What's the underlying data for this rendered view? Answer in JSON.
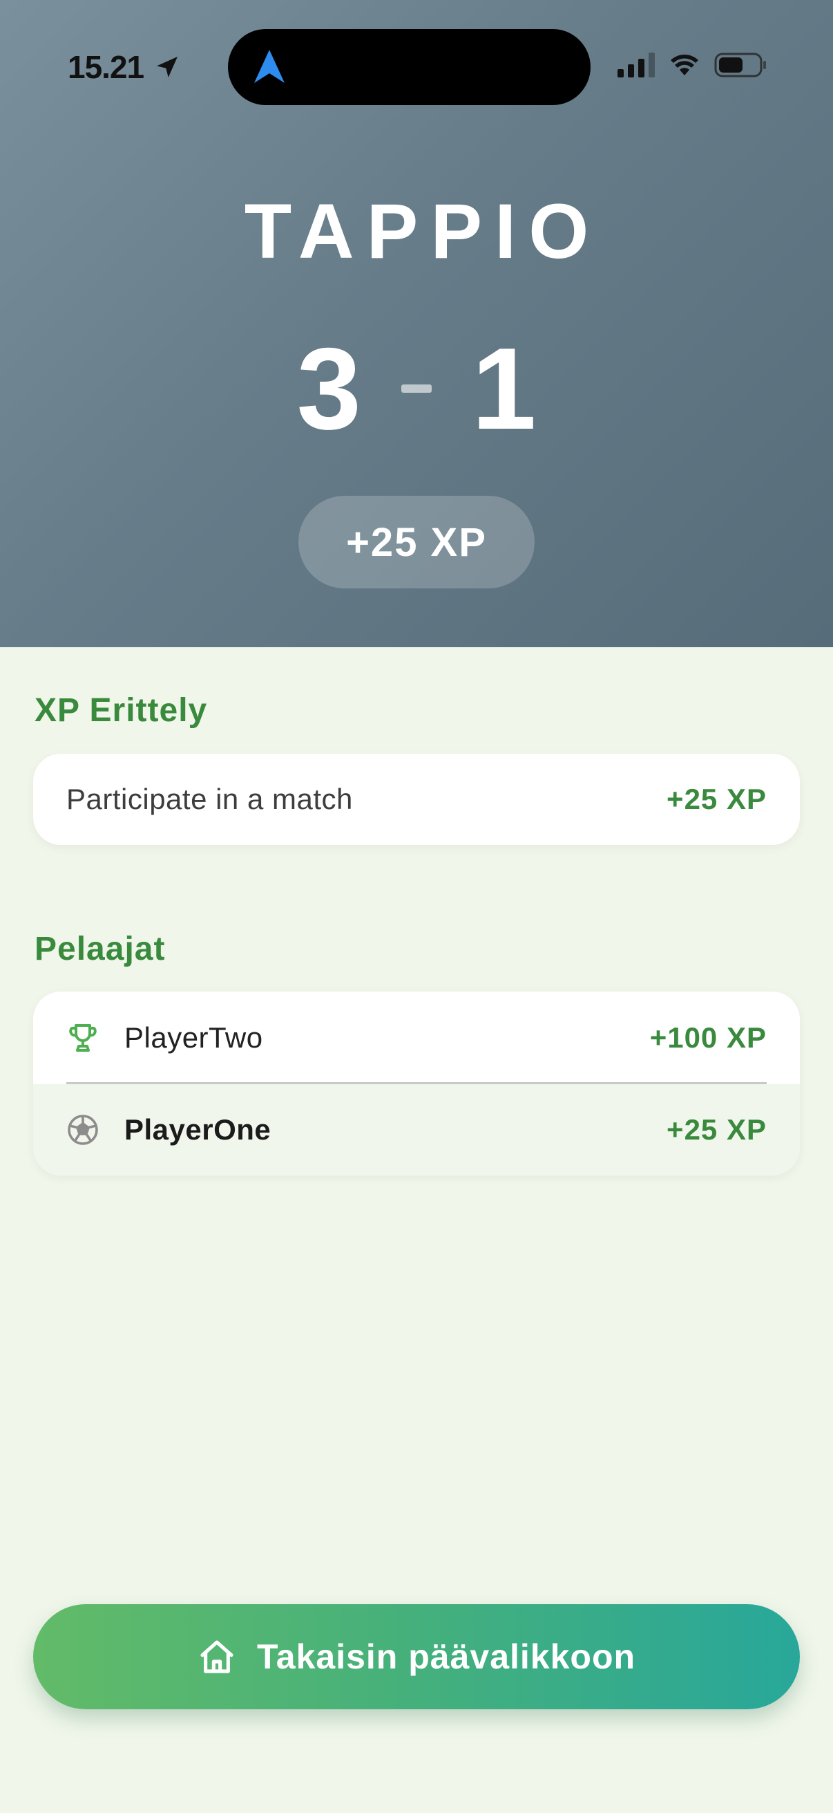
{
  "status_bar": {
    "time": "15.21"
  },
  "result": {
    "title": "TAPPIO",
    "score_home": "3",
    "score_away": "1",
    "xp_gained": "+25 XP"
  },
  "xp_breakdown": {
    "title": "XP Erittely",
    "items": [
      {
        "label": "Participate in a match",
        "xp": "+25 XP"
      }
    ]
  },
  "players": {
    "title": "Pelaajat",
    "items": [
      {
        "name": "PlayerTwo",
        "xp": "+100 XP",
        "icon": "trophy-icon"
      },
      {
        "name": "PlayerOne",
        "xp": "+25 XP",
        "icon": "soccer-ball-icon"
      }
    ]
  },
  "home_button": {
    "label": "Takaisin päävalikkoon",
    "icon": "home-icon"
  },
  "colors": {
    "accent_green": "#3a8a3e",
    "background": "#f0f6ea",
    "button_gradient_start": "#62bb68",
    "button_gradient_end": "#28a79a"
  }
}
